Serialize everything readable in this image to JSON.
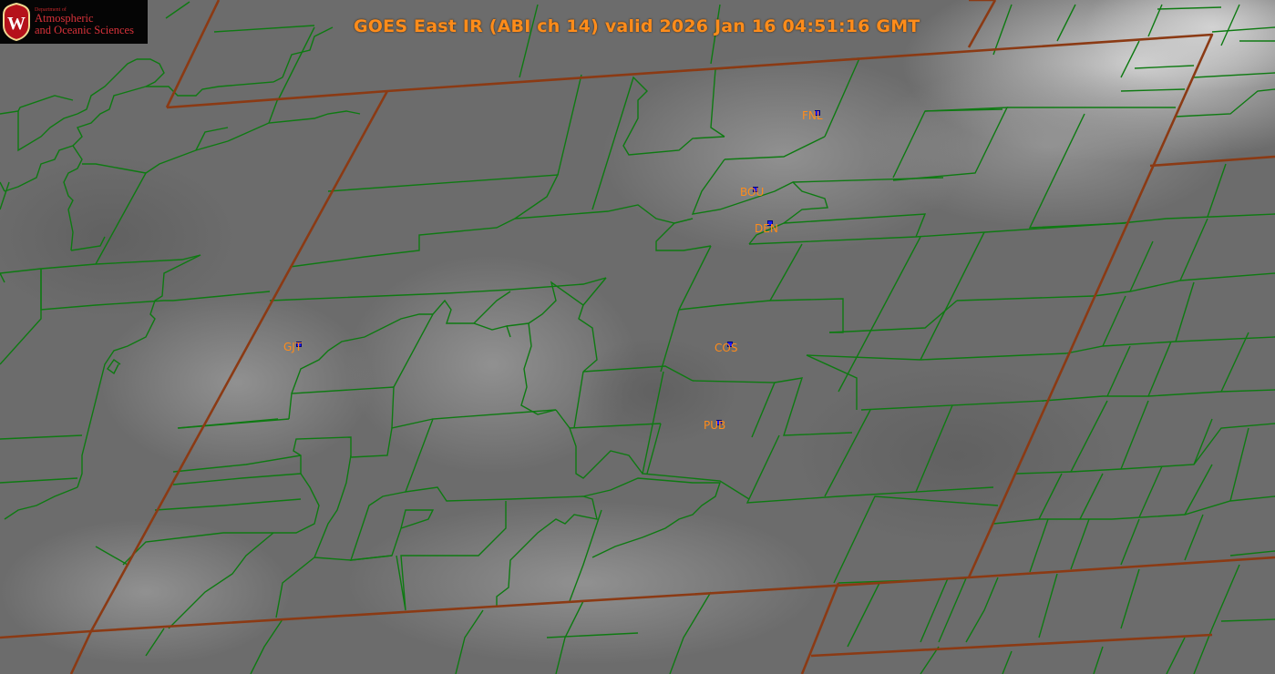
{
  "header": {
    "title": "GOES East IR (ABI ch 14) valid 2026 Jan 16 04:51:16 GMT"
  },
  "logo": {
    "dept_label": "Department of",
    "line1": "Atmospheric",
    "line2": "and Oceanic Sciences",
    "emblem_letter": "W",
    "emblem_color": "#b5121b"
  },
  "colors": {
    "state_border": "#8b3a14",
    "county_border": "#0e7a12",
    "station_label": "#ff8c1a",
    "station_marker": "#1a1aff"
  },
  "stations": [
    {
      "id": "FNL"
    },
    {
      "id": "BOU"
    },
    {
      "id": "DEN"
    },
    {
      "id": "GJT"
    },
    {
      "id": "COS"
    },
    {
      "id": "PUB"
    }
  ]
}
